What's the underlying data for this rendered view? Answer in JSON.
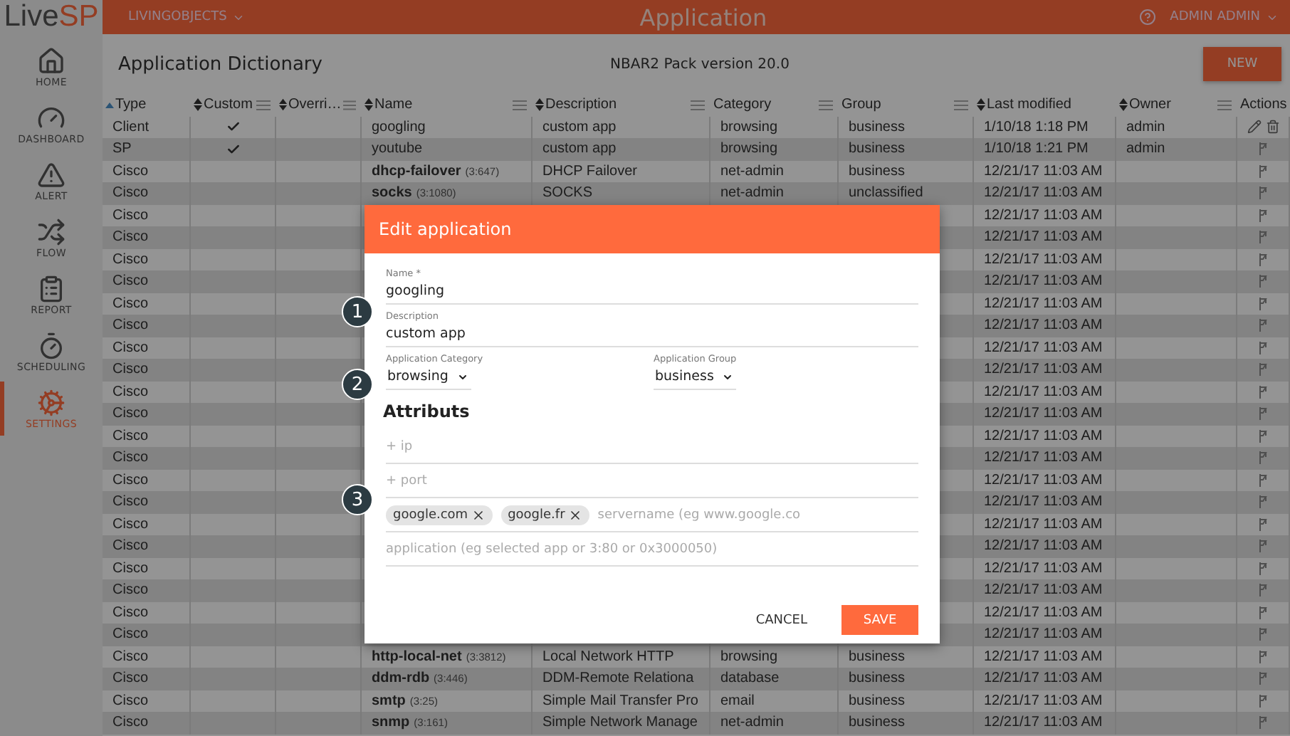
{
  "sidebar": {
    "logo": {
      "part_1": "Live",
      "part_2": "SP"
    },
    "items": [
      {
        "label": "HOME",
        "selected": false
      },
      {
        "label": "DASHBOARD",
        "selected": false
      },
      {
        "label": "ALERT",
        "selected": false
      },
      {
        "label": "FLOW",
        "selected": false
      },
      {
        "label": "REPORT",
        "selected": false
      },
      {
        "label": "SCHEDULING",
        "selected": false
      },
      {
        "label": "SETTINGS",
        "selected": true
      }
    ]
  },
  "top_bar": {
    "org": "LIVINGOBJECTS",
    "title": "Application",
    "user": "ADMIN ADMIN"
  },
  "page": {
    "title": "Application Dictionary",
    "subtitle": "NBAR2 Pack version 20.0",
    "new_button": "NEW"
  },
  "table": {
    "columns": [
      {
        "label": "Type",
        "kind": "asc",
        "menu": false
      },
      {
        "label": "Custom",
        "kind": "sortable",
        "menu": true
      },
      {
        "label": "Overri…",
        "kind": "sortable",
        "menu": true
      },
      {
        "label": "Name",
        "kind": "sortable",
        "menu": true
      },
      {
        "label": "Description",
        "kind": "sortable",
        "menu": true
      },
      {
        "label": "Category",
        "kind": "plain",
        "menu": true
      },
      {
        "label": "Group",
        "kind": "plain",
        "menu": true
      },
      {
        "label": "Last modified",
        "kind": "sortable",
        "menu": false
      },
      {
        "label": "Owner",
        "kind": "sortable",
        "menu": true
      },
      {
        "label": "Actions",
        "kind": "plain",
        "menu": false
      }
    ],
    "rows": [
      {
        "kind": "custom",
        "type": "Client",
        "custom": true,
        "name": "googling",
        "description": "custom app",
        "category": "browsing",
        "group": "business",
        "last_modified": "1/10/18 1:18 PM",
        "owner": "admin"
      },
      {
        "kind": "builtin",
        "type": "SP",
        "custom": true,
        "name": "youtube",
        "description": "custom app",
        "category": "browsing",
        "group": "business",
        "last_modified": "1/10/18 1:21 PM",
        "owner": "admin"
      },
      {
        "kind": "builtin",
        "type": "Cisco",
        "custom": false,
        "name": "dhcp-failover",
        "code": "(3:647)",
        "description": "DHCP Failover",
        "category": "net-admin",
        "group": "business",
        "last_modified": "12/21/17 11:03 AM"
      },
      {
        "kind": "builtin",
        "type": "Cisco",
        "custom": false,
        "name": "socks",
        "code": "(3:1080)",
        "description": "SOCKS",
        "category": "net-admin",
        "group": "unclassified",
        "last_modified": "12/21/17 11:03 AM"
      },
      {
        "kind": "builtin",
        "type": "Cisco",
        "custom": false,
        "last_modified": "12/21/17 11:03 AM"
      },
      {
        "kind": "builtin",
        "type": "Cisco",
        "custom": false,
        "last_modified": "12/21/17 11:03 AM"
      },
      {
        "kind": "builtin",
        "type": "Cisco",
        "custom": false,
        "last_modified": "12/21/17 11:03 AM"
      },
      {
        "kind": "builtin",
        "type": "Cisco",
        "custom": false,
        "last_modified": "12/21/17 11:03 AM"
      },
      {
        "kind": "builtin",
        "type": "Cisco",
        "custom": false,
        "last_modified": "12/21/17 11:03 AM"
      },
      {
        "kind": "builtin",
        "type": "Cisco",
        "custom": false,
        "last_modified": "12/21/17 11:03 AM"
      },
      {
        "kind": "builtin",
        "type": "Cisco",
        "custom": false,
        "last_modified": "12/21/17 11:03 AM"
      },
      {
        "kind": "builtin",
        "type": "Cisco",
        "custom": false,
        "last_modified": "12/21/17 11:03 AM"
      },
      {
        "kind": "builtin",
        "type": "Cisco",
        "custom": false,
        "last_modified": "12/21/17 11:03 AM"
      },
      {
        "kind": "builtin",
        "type": "Cisco",
        "custom": false,
        "last_modified": "12/21/17 11:03 AM"
      },
      {
        "kind": "builtin",
        "type": "Cisco",
        "custom": false,
        "last_modified": "12/21/17 11:03 AM"
      },
      {
        "kind": "builtin",
        "type": "Cisco",
        "custom": false,
        "last_modified": "12/21/17 11:03 AM"
      },
      {
        "kind": "builtin",
        "type": "Cisco",
        "custom": false,
        "last_modified": "12/21/17 11:03 AM"
      },
      {
        "kind": "builtin",
        "type": "Cisco",
        "custom": false,
        "last_modified": "12/21/17 11:03 AM"
      },
      {
        "kind": "builtin",
        "type": "Cisco",
        "custom": false,
        "last_modified": "12/21/17 11:03 AM"
      },
      {
        "kind": "builtin",
        "type": "Cisco",
        "custom": false,
        "last_modified": "12/21/17 11:03 AM"
      },
      {
        "kind": "builtin",
        "type": "Cisco",
        "custom": false,
        "last_modified": "12/21/17 11:03 AM"
      },
      {
        "kind": "builtin",
        "type": "Cisco",
        "custom": false,
        "last_modified": "12/21/17 11:03 AM"
      },
      {
        "kind": "builtin",
        "type": "Cisco",
        "custom": false,
        "last_modified": "12/21/17 11:03 AM"
      },
      {
        "kind": "builtin",
        "type": "Cisco",
        "custom": false,
        "last_modified": "12/21/17 11:03 AM"
      },
      {
        "kind": "builtin",
        "type": "Cisco",
        "custom": false,
        "name": "http-local-net",
        "code": "(3:3812)",
        "description": "Local Network HTTP",
        "category": "browsing",
        "group": "business",
        "last_modified": "12/21/17 11:03 AM"
      },
      {
        "kind": "builtin",
        "type": "Cisco",
        "custom": false,
        "name": "ddm-rdb",
        "code": "(3:446)",
        "description": "DDM-Remote Relationa",
        "category": "database",
        "group": "business",
        "last_modified": "12/21/17 11:03 AM"
      },
      {
        "kind": "builtin",
        "type": "Cisco",
        "custom": false,
        "name": "smtp",
        "code": "(3:25)",
        "description": "Simple Mail Transfer Pro",
        "category": "email",
        "group": "business",
        "last_modified": "12/21/17 11:03 AM"
      },
      {
        "kind": "builtin",
        "type": "Cisco",
        "custom": false,
        "name": "snmp",
        "code": "(3:161)",
        "description": "Simple Network Manage",
        "category": "net-admin",
        "group": "business",
        "last_modified": "12/21/17 11:03 AM"
      }
    ]
  },
  "dialog": {
    "title": "Edit application",
    "fields": [
      {
        "label": "Name *",
        "value": "googling"
      },
      {
        "label": "Description",
        "value": "custom app"
      }
    ],
    "selects": [
      {
        "label": "Application Category",
        "value": "browsing"
      },
      {
        "label": "Application Group",
        "value": "business"
      }
    ],
    "section": "Attributs",
    "attributes": [
      {
        "kind": "input",
        "placeholder": "+ ip"
      },
      {
        "kind": "input",
        "placeholder": "+ port"
      },
      {
        "kind": "chips",
        "chips": [
          "google.com",
          "google.fr"
        ],
        "placeholder": "servername (eg www.google.co"
      },
      {
        "kind": "input",
        "placeholder": "application (eg selected app or 3:80 or 0x3000050)"
      }
    ],
    "buttons": [
      {
        "label": "CANCEL",
        "kind": "flat"
      },
      {
        "label": "SAVE",
        "kind": "primary"
      }
    ],
    "callouts": [
      "1",
      "2",
      "3"
    ]
  }
}
